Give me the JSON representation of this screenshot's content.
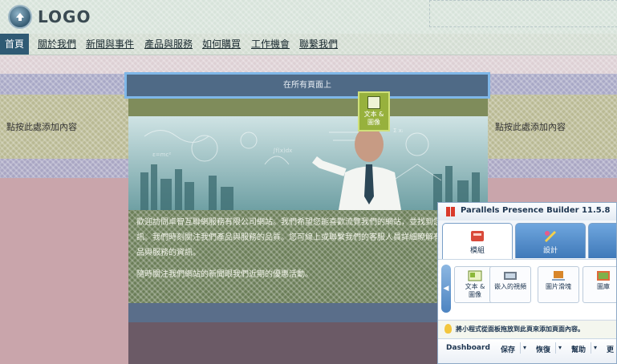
{
  "header": {
    "logo_text": "LOGO"
  },
  "nav": {
    "items": [
      {
        "label": "首頁",
        "active": true
      },
      {
        "label": "關於我們"
      },
      {
        "label": "新聞與事件"
      },
      {
        "label": "產品與服務"
      },
      {
        "label": "如何購買"
      },
      {
        "label": "工作機會"
      },
      {
        "label": "聯繫我們"
      }
    ]
  },
  "layout_placeholders": {
    "left_add_content": "點按此處添加內容",
    "right_add_content": "點按此處添加內容",
    "all_pages_label": "在所有頁面上"
  },
  "widget": {
    "label_line1": "文本 &",
    "label_line2": "圖像",
    "icon": "text-image-icon"
  },
  "content": {
    "paragraph1": "歡迎訪問卓智互聯網服務有限公司網站。我們希望您能喜歡流覽我們的網站，並找到您需要的資訊。我們時刻關注我們產品與服務的品質。您可線上或聯繫我們的客服人員詳細瞭解有關我們產品與服務的資訊。",
    "paragraph2": "隨時關注我們網站的新聞眼我們近期的優惠活動。"
  },
  "builder_panel": {
    "title": "Parallels Presence Builder 11.5.8",
    "tabs": [
      {
        "label": "模組",
        "icon": "modules-icon",
        "active": true
      },
      {
        "label": "設計",
        "icon": "design-icon"
      },
      {
        "label": "",
        "icon": "more-icon"
      }
    ],
    "items": [
      {
        "label": "文本 &\n圖像",
        "line1": "文本 &",
        "line2": "圖像",
        "icon": "text-image-icon"
      },
      {
        "label": "嵌入的視頻",
        "icon": "video-icon"
      },
      {
        "label": "圖片滑塊",
        "icon": "slider-icon"
      },
      {
        "label": "圖庫",
        "icon": "gallery-icon"
      }
    ],
    "hint": "將小程式從面板拖放到此頁來添加頁面內容。",
    "bottom": {
      "dashboard": "Dashboard",
      "save": "保存",
      "restore": "恢復",
      "help": "幫助",
      "more": "更"
    }
  }
}
